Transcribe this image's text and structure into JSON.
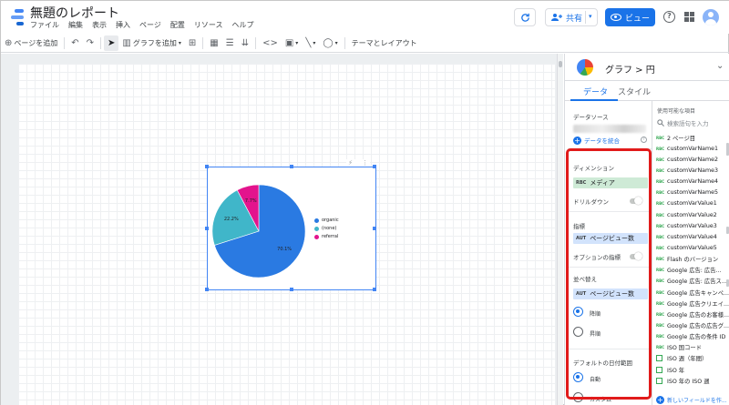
{
  "header": {
    "title": "無題のレポート",
    "menu": [
      "ファイル",
      "編集",
      "表示",
      "挿入",
      "ページ",
      "配置",
      "リソース",
      "ヘルプ"
    ],
    "share_label": "共有",
    "view_label": "ビュー",
    "colors": {
      "accent": "#1a73e8"
    }
  },
  "toolbar": {
    "add_page": "ページを追加",
    "add_chart": "グラフを追加",
    "theme_layout": "テーマとレイアウト"
  },
  "chart_data": {
    "type": "pie",
    "categories": [
      "organic",
      "(none)",
      "referral"
    ],
    "values": [
      70.1,
      22.2,
      7.7
    ],
    "labels": [
      "70.1%",
      "22.2%",
      "7.7%"
    ],
    "colors": [
      "#2a7ae2",
      "#40b6c9",
      "#e3148d"
    ],
    "legend_position": "right"
  },
  "panel": {
    "chart_type_label": "グラフ > 円",
    "tabs": {
      "data": "データ",
      "style": "スタイル"
    },
    "data_source_label": "データソース",
    "blend_label": "データを統合",
    "dimension_label": "ディメンション",
    "dimension_type": "RBC",
    "dimension_value": "メディア",
    "drilldown_label": "ドリルダウン",
    "metric_label": "指標",
    "metric_type": "AUT",
    "metric_value": "ページビュー数",
    "optional_metrics_label": "オプションの指標",
    "sort_label": "並べ替え",
    "sort_type": "AUT",
    "sort_value": "ページビュー数",
    "sort_desc": "降順",
    "sort_asc": "昇順",
    "date_range_label": "デフォルトの日付範囲",
    "date_auto": "自動",
    "date_custom": "カスタム"
  },
  "fields": {
    "title": "使用可能な項目",
    "search_placeholder": "検索語句を入力",
    "items": [
      "2 ページ目",
      "customVarName1",
      "customVarName2",
      "customVarName3",
      "customVarName4",
      "customVarName5",
      "customVarValue1",
      "customVarValue2",
      "customVarValue3",
      "customVarValue4",
      "customVarValue5",
      "Flash のバージョン",
      "Google 広告: 広告...",
      "Google 広告: 広告ス...",
      "Google 広告キャンペ...",
      "Google 広告クリエイ...",
      "Google 広告のお客様...",
      "Google 広告の広告グ...",
      "Google 広告の条件 ID",
      "ISO 国コード",
      "ISO 週（年間）",
      "ISO 年",
      "ISO 年の ISO 週"
    ],
    "new_field_label": "新しいフィールドを作..."
  }
}
